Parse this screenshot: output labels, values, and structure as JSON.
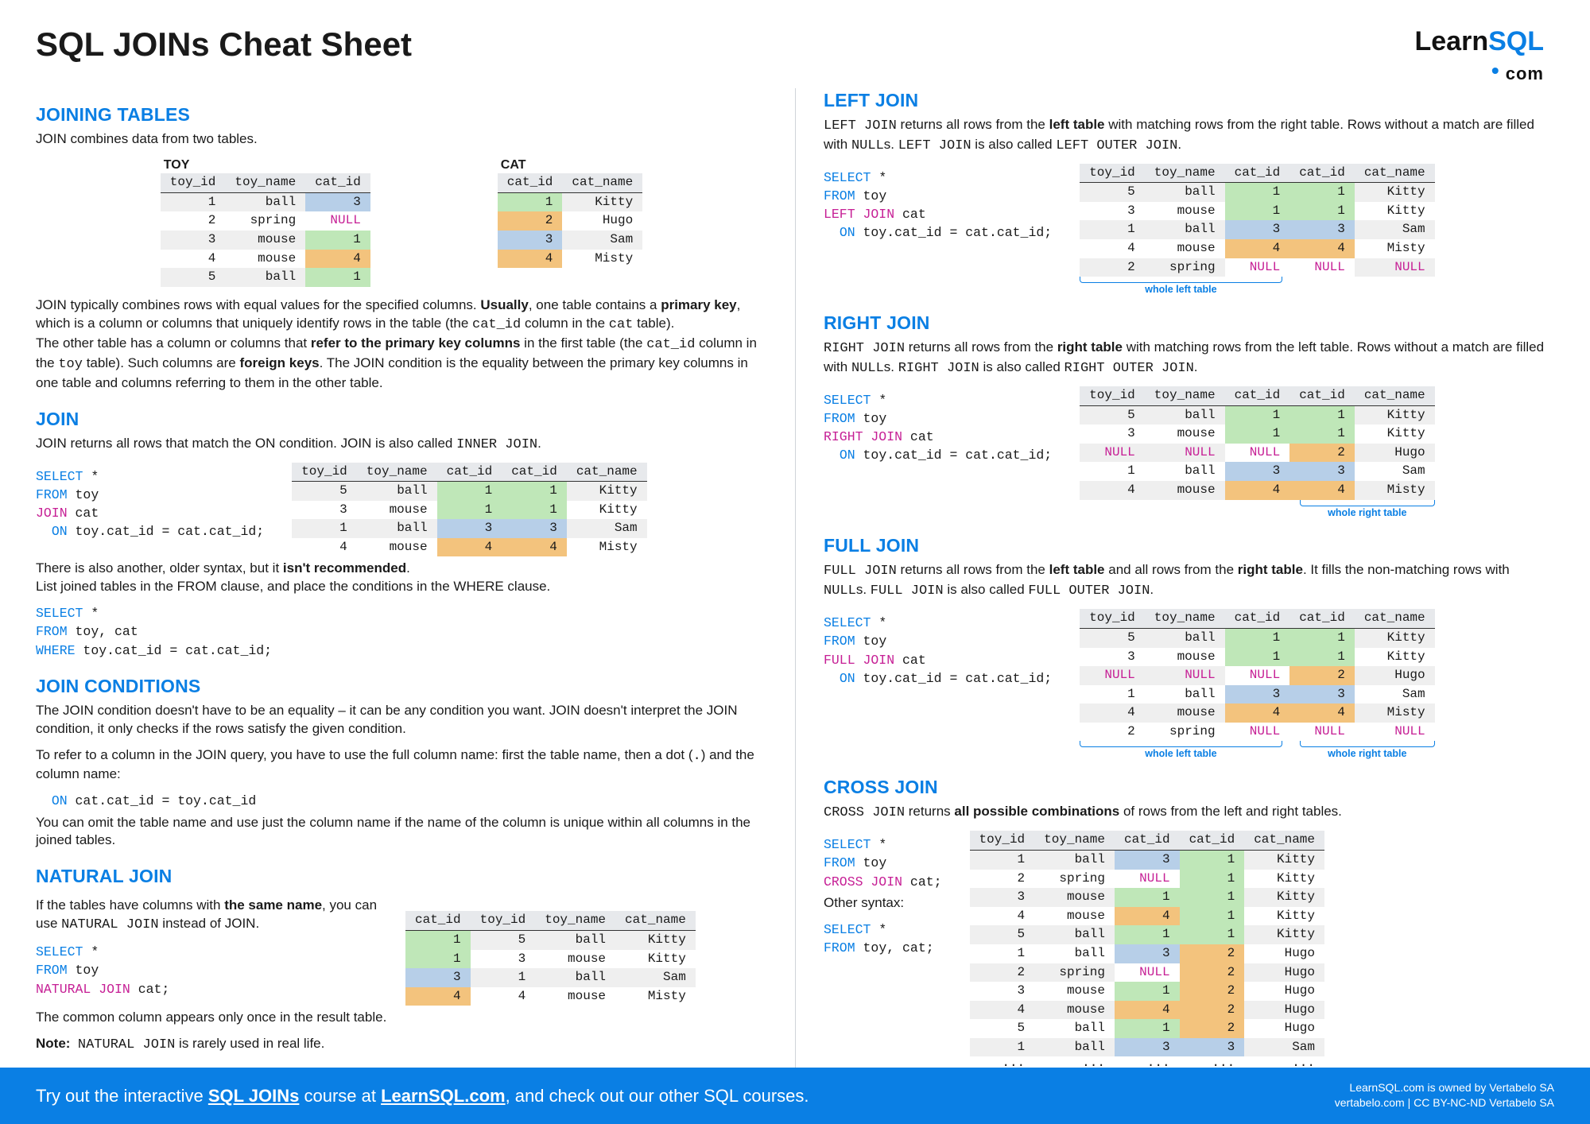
{
  "logo": {
    "brand1": "Learn",
    "brand2": "SQL",
    "com": "com"
  },
  "title": "SQL JOINs Cheat Sheet",
  "s1": {
    "h": "JOINING TABLES",
    "intro": "JOIN combines data from two tables.",
    "toy_label": "TOY",
    "cat_label": "CAT",
    "toy_cols": [
      "toy_id",
      "toy_name",
      "cat_id"
    ],
    "cat_cols": [
      "cat_id",
      "cat_name"
    ],
    "toy_rows": [
      [
        "1",
        "ball",
        "3"
      ],
      [
        "2",
        "spring",
        "NULL"
      ],
      [
        "3",
        "mouse",
        "1"
      ],
      [
        "4",
        "mouse",
        "4"
      ],
      [
        "5",
        "ball",
        "1"
      ]
    ],
    "cat_rows": [
      [
        "1",
        "Kitty"
      ],
      [
        "2",
        "Hugo"
      ],
      [
        "3",
        "Sam"
      ],
      [
        "4",
        "Misty"
      ]
    ],
    "para": "JOIN typically combines rows with equal values for the specified columns. Usually, one table contains a primary key, which is a column or columns that uniquely identify rows in the table (the cat_id column in the cat table).\nThe other table has a column or columns that refer to the primary key columns in the first table (the cat_id column in the toy table). Such columns are foreign keys. The JOIN condition is the equality between the primary key columns in one table and columns referring to them in the other table."
  },
  "s_join": {
    "h": "JOIN",
    "desc": "JOIN returns all rows that match the ON condition. JOIN is also called INNER JOIN.",
    "code": [
      "SELECT *",
      "FROM toy",
      "JOIN cat",
      "  ON toy.cat_id = cat.cat_id;"
    ],
    "res_cols": [
      "toy_id",
      "toy_name",
      "cat_id",
      "cat_id",
      "cat_name"
    ],
    "res": [
      [
        "5",
        "ball",
        "1",
        "1",
        "Kitty"
      ],
      [
        "3",
        "mouse",
        "1",
        "1",
        "Kitty"
      ],
      [
        "1",
        "ball",
        "3",
        "3",
        "Sam"
      ],
      [
        "4",
        "mouse",
        "4",
        "4",
        "Misty"
      ]
    ],
    "note1": "There is also another, older syntax, but it isn't recommended.",
    "note2": "List joined tables in the FROM clause, and place the conditions in the WHERE clause.",
    "code2": [
      "SELECT *",
      "FROM toy, cat",
      "WHERE toy.cat_id = cat.cat_id;"
    ]
  },
  "s_cond": {
    "h": "JOIN CONDITIONS",
    "p1": "The JOIN condition doesn't have to be an equality – it can be any condition you want. JOIN doesn't interpret the JOIN condition, it only checks if the rows satisfy the given condition.",
    "p2a": "To refer to a column in the JOIN query, you have to use the full column name: first the table name, then a dot (",
    "dot": ".",
    "p2b": ") and the column name:",
    "cond": "  ON cat.cat_id = toy.cat_id",
    "p3": "You can omit the table name and use just the column name if the name of the column is unique within all columns in the joined tables."
  },
  "s_nat": {
    "h": "NATURAL JOIN",
    "p1a": "If the tables have columns with ",
    "p1b": "the same name",
    "p1c": ", you can use NATURAL JOIN instead of JOIN.",
    "code": [
      "SELECT *",
      "FROM toy",
      "NATURAL JOIN cat;"
    ],
    "p2": "The common column appears only once in the result table.",
    "p3": "Note:  NATURAL JOIN is rarely used in real life.",
    "res_cols": [
      "cat_id",
      "toy_id",
      "toy_name",
      "cat_name"
    ],
    "res": [
      [
        "1",
        "5",
        "ball",
        "Kitty"
      ],
      [
        "1",
        "3",
        "mouse",
        "Kitty"
      ],
      [
        "3",
        "1",
        "ball",
        "Sam"
      ],
      [
        "4",
        "4",
        "mouse",
        "Misty"
      ]
    ]
  },
  "s_left": {
    "h": "LEFT JOIN",
    "p": "LEFT JOIN returns all rows from the left table with matching rows from the right table. Rows without a match are filled with NULLs. LEFT JOIN is also called LEFT OUTER JOIN.",
    "code": [
      "SELECT *",
      "FROM toy",
      "LEFT JOIN cat",
      "  ON toy.cat_id = cat.cat_id;"
    ],
    "res_cols": [
      "toy_id",
      "toy_name",
      "cat_id",
      "cat_id",
      "cat_name"
    ],
    "res": [
      [
        "5",
        "ball",
        "1",
        "1",
        "Kitty"
      ],
      [
        "3",
        "mouse",
        "1",
        "1",
        "Kitty"
      ],
      [
        "1",
        "ball",
        "3",
        "3",
        "Sam"
      ],
      [
        "4",
        "mouse",
        "4",
        "4",
        "Misty"
      ],
      [
        "2",
        "spring",
        "NULL",
        "NULL",
        "NULL"
      ]
    ],
    "brace": "whole left table"
  },
  "s_right": {
    "h": "RIGHT JOIN",
    "p": "RIGHT JOIN returns all rows from the right table with matching rows from the left table. Rows without a match are filled with NULLs. RIGHT JOIN is also called RIGHT OUTER JOIN.",
    "code": [
      "SELECT *",
      "FROM toy",
      "RIGHT JOIN cat",
      "  ON toy.cat_id = cat.cat_id;"
    ],
    "res_cols": [
      "toy_id",
      "toy_name",
      "cat_id",
      "cat_id",
      "cat_name"
    ],
    "res": [
      [
        "5",
        "ball",
        "1",
        "1",
        "Kitty"
      ],
      [
        "3",
        "mouse",
        "1",
        "1",
        "Kitty"
      ],
      [
        "NULL",
        "NULL",
        "NULL",
        "2",
        "Hugo"
      ],
      [
        "1",
        "ball",
        "3",
        "3",
        "Sam"
      ],
      [
        "4",
        "mouse",
        "4",
        "4",
        "Misty"
      ]
    ],
    "brace": "whole right table"
  },
  "s_full": {
    "h": "FULL JOIN",
    "p": "FULL JOIN returns all rows from the left table and all rows from the right table. It fills the non-matching rows with NULLs. FULL JOIN is also called FULL OUTER JOIN.",
    "code": [
      "SELECT *",
      "FROM toy",
      "FULL JOIN cat",
      "  ON toy.cat_id = cat.cat_id;"
    ],
    "res_cols": [
      "toy_id",
      "toy_name",
      "cat_id",
      "cat_id",
      "cat_name"
    ],
    "res": [
      [
        "5",
        "ball",
        "1",
        "1",
        "Kitty"
      ],
      [
        "3",
        "mouse",
        "1",
        "1",
        "Kitty"
      ],
      [
        "NULL",
        "NULL",
        "NULL",
        "2",
        "Hugo"
      ],
      [
        "1",
        "ball",
        "3",
        "3",
        "Sam"
      ],
      [
        "4",
        "mouse",
        "4",
        "4",
        "Misty"
      ],
      [
        "2",
        "spring",
        "NULL",
        "NULL",
        "NULL"
      ]
    ],
    "brace_l": "whole left table",
    "brace_r": "whole right table"
  },
  "s_cross": {
    "h": "CROSS JOIN",
    "p": "CROSS JOIN returns all possible combinations of rows from the left and right tables.",
    "code": [
      "SELECT *",
      "FROM toy",
      "CROSS JOIN cat;"
    ],
    "other": "Other syntax:",
    "code2": [
      "SELECT *",
      "FROM toy, cat;"
    ],
    "res_cols": [
      "toy_id",
      "toy_name",
      "cat_id",
      "cat_id",
      "cat_name"
    ],
    "res": [
      [
        "1",
        "ball",
        "3",
        "1",
        "Kitty"
      ],
      [
        "2",
        "spring",
        "NULL",
        "1",
        "Kitty"
      ],
      [
        "3",
        "mouse",
        "1",
        "1",
        "Kitty"
      ],
      [
        "4",
        "mouse",
        "4",
        "1",
        "Kitty"
      ],
      [
        "5",
        "ball",
        "1",
        "1",
        "Kitty"
      ],
      [
        "1",
        "ball",
        "3",
        "2",
        "Hugo"
      ],
      [
        "2",
        "spring",
        "NULL",
        "2",
        "Hugo"
      ],
      [
        "3",
        "mouse",
        "1",
        "2",
        "Hugo"
      ],
      [
        "4",
        "mouse",
        "4",
        "2",
        "Hugo"
      ],
      [
        "5",
        "ball",
        "1",
        "2",
        "Hugo"
      ],
      [
        "1",
        "ball",
        "3",
        "3",
        "Sam"
      ],
      [
        "···",
        "···",
        "···",
        "···",
        "···"
      ]
    ]
  },
  "footer": {
    "text_a": "Try out the interactive ",
    "link1": "SQL JOINs",
    "text_b": " course at ",
    "link2": "LearnSQL.com",
    "text_c": ", and check out our other SQL courses.",
    "c1": "LearnSQL.com is owned by Vertabelo SA",
    "c2": "vertabelo.com | CC BY-NC-ND Vertabelo SA"
  }
}
